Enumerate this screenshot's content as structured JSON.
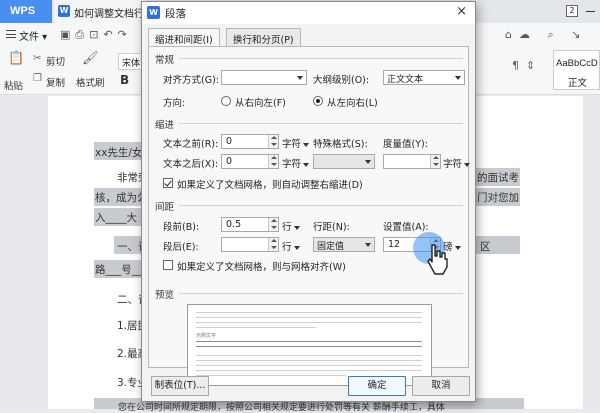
{
  "titlebar": {
    "app_tab": "WPS",
    "doc_tab": "如何调整文档行距",
    "badge": "2"
  },
  "menubar": {
    "file_label": "文件"
  },
  "ribbon": {
    "paste_label": "粘贴",
    "cut_label": "剪切",
    "copy_label": "复制",
    "format_painter_label": "格式刷",
    "font_name": "宋体",
    "bold_label": "B",
    "style_preview": "AaBbCcD",
    "style_name": "正文"
  },
  "document": {
    "lines": [
      "xx先生/女",
      "非常荣",
      "的面试考",
      "核，成为公",
      "门对您加",
      "入____大",
      "一、请",
      "区",
      "路___号___",
      "二、请",
      "1.居民",
      "2.最高",
      "3.专业",
      "您在公司时间所规定期限，按照公司相关规定要进行处罚等有关 薪酬手续工，具体"
    ]
  },
  "dialog": {
    "title": "段落",
    "close_label": "×",
    "tabs": [
      {
        "label": "缩进和间距(I)",
        "active": true
      },
      {
        "label": "换行和分页(P)",
        "active": false
      }
    ],
    "general": {
      "heading": "常规",
      "alignment_label": "对齐方式(G):",
      "alignment_value": "",
      "outline_label": "大纲级别(O):",
      "outline_value": "正文文本",
      "direction_label": "方向:",
      "rtl_label": "从右向左(F)",
      "ltr_label": "从左向右(L)",
      "direction_selected": "ltr"
    },
    "indent": {
      "heading": "缩进",
      "before_label": "文本之前(R):",
      "before_value": "0",
      "before_unit": "字符",
      "after_label": "文本之后(X):",
      "after_value": "0",
      "after_unit": "字符",
      "special_label": "特殊格式(S):",
      "special_value": "",
      "measure_label": "度量值(Y):",
      "measure_value": "",
      "measure_unit": "字符",
      "auto_adjust_label": "如果定义了文档网格，则自动调整右缩进(D)",
      "auto_adjust_checked": true
    },
    "spacing": {
      "heading": "间距",
      "before_label": "段前(B):",
      "before_value": "0.5",
      "before_unit": "行",
      "after_label": "段后(E):",
      "after_value": "",
      "after_unit": "行",
      "line_spacing_label": "行距(N):",
      "line_spacing_value": "固定值",
      "setting_label": "设置值(A):",
      "setting_value": "12",
      "setting_unit": "磅",
      "snap_grid_label": "如果定义了文档网格，则与网格对齐(W)",
      "snap_grid_checked": false
    },
    "preview": {
      "heading": "预览",
      "sample_label": "示例文字"
    },
    "buttons": {
      "tabs_label": "制表位(T)...",
      "ok_label": "确定",
      "cancel_label": "取消"
    }
  },
  "colors": {
    "accent": "#2f6fdf",
    "wps_tab": "#4a8ef0",
    "highlight": "#c8cbcf",
    "cursor_halo": "#4091f0"
  }
}
